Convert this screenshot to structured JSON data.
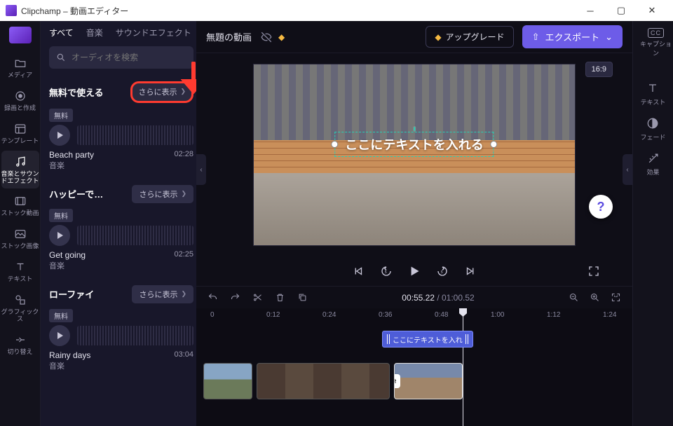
{
  "window": {
    "title": "Clipchamp – 動画エディター"
  },
  "nav": {
    "items": [
      {
        "id": "media",
        "label": "メディア"
      },
      {
        "id": "record",
        "label": "録画と作成"
      },
      {
        "id": "template",
        "label": "テンプレート"
      },
      {
        "id": "music",
        "label": "音楽とサウンドエフェクト",
        "active": true
      },
      {
        "id": "stockvid",
        "label": "ストック動画"
      },
      {
        "id": "stockimg",
        "label": "ストック画像"
      },
      {
        "id": "text",
        "label": "テキスト"
      },
      {
        "id": "graphics",
        "label": "グラフィックス"
      },
      {
        "id": "transition",
        "label": "切り替え"
      }
    ]
  },
  "panel": {
    "tabs": {
      "all": "すべて",
      "music": "音楽",
      "sfx": "サウンドエフェクト"
    },
    "search_placeholder": "オーディオを検索",
    "more_label": "さらに表示",
    "free_badge": "無料",
    "genre_music": "音楽",
    "sections": [
      {
        "title": "無料で使える",
        "highlight": true,
        "track": {
          "name": "Beach party",
          "duration": "02:28"
        }
      },
      {
        "title": "ハッピーで…",
        "track": {
          "name": "Get going",
          "duration": "02:25"
        }
      },
      {
        "title": "ローファイ",
        "track": {
          "name": "Rainy days",
          "duration": "03:04"
        }
      }
    ]
  },
  "topbar": {
    "title": "無題の動画",
    "upgrade": "アップグレード",
    "export": "エクスポート",
    "caption_btn": "キャプション",
    "cc": "CC"
  },
  "preview": {
    "aspect": "16:9",
    "text_overlay": "ここにテキストを入れる",
    "help": "?"
  },
  "props": {
    "text": "テキスト",
    "fade": "フェード",
    "effects": "効果"
  },
  "timecode": {
    "current": "00:55.22",
    "duration": "01:00.52"
  },
  "ruler_ticks": [
    "0",
    "0:12",
    "0:24",
    "0:36",
    "0:48",
    "1:00",
    "1:12",
    "1:24"
  ],
  "text_clip_label": "ここにテキストを入れ",
  "colors": {
    "accent": "#6d5ce8",
    "highlight": "#ff3b30",
    "teal": "#25d0b6"
  }
}
